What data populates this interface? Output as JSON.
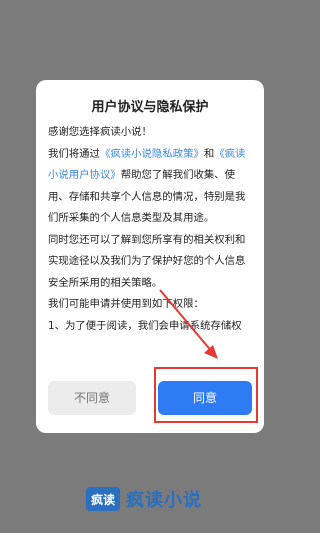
{
  "dialog": {
    "title": "用户协议与隐私保护",
    "greeting": "感谢您选择疯读小说！",
    "p1_pre": "我们将通过",
    "privacy_link": "《疯读小说隐私政策》",
    "p1_and": "和",
    "user_link": "《疯读小说用户协议》",
    "p1_post": "帮助您了解我们收集、使用、存储和共享个人信息的情况，特别是我们所采集的个人信息类型及其用途。",
    "p2": "同时您还可以了解到您所享有的相关权利和实现途径以及我们为了保护好您的个人信息安全所采用的相关策略。",
    "p3": "我们可能申请并使用到如下权限：",
    "p4": "1、为了便于阅读，我们会申请系统存储权",
    "disagree_label": "不同意",
    "agree_label": "同意"
  },
  "brand": {
    "logo_text": "疯读",
    "name": "疯读小说"
  },
  "colors": {
    "overlay": "#7b7b7b",
    "link": "#3a87e8",
    "agree": "#2f7bf4",
    "annotation": "#e53935"
  }
}
